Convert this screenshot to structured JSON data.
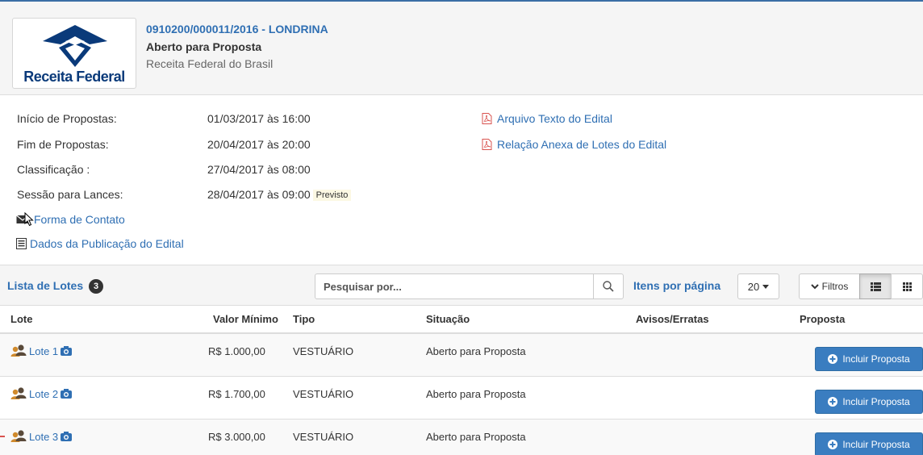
{
  "header": {
    "logo_text": "Receita Federal",
    "process_number": "0910200/000011/2016 - LONDRINA",
    "status": "Aberto para Proposta",
    "organization": "Receita Federal do Brasil"
  },
  "info": {
    "start_label": "Início de Propostas:",
    "start_value": "01/03/2017 às 16:00",
    "end_label": "Fim de Propostas:",
    "end_value": "20/04/2017 às 20:00",
    "class_label": "Classificação :",
    "class_value": "27/04/2017 às 08:00",
    "session_label": "Sessão para Lances:",
    "session_value": "28/04/2017 às 09:00",
    "session_badge": "Previsto"
  },
  "links": {
    "contact": "Forma de Contato",
    "publication": "Dados da Publicação do Edital",
    "edital_text": "Arquivo Texto do Edital",
    "edital_annex": "Relação Anexa de Lotes do Edital"
  },
  "lots_bar": {
    "title": "Lista de Lotes",
    "count": "3",
    "search_placeholder": "Pesquisar por...",
    "per_page_label": "Itens por página",
    "per_page_value": "20",
    "filter_label": "Filtros"
  },
  "table": {
    "columns": {
      "lote": "Lote",
      "valor": "Valor Mínimo",
      "tipo": "Tipo",
      "situacao": "Situação",
      "avisos": "Avisos/Erratas",
      "proposta": "Proposta"
    },
    "rows": [
      {
        "lote": "Lote 1",
        "valor": "R$ 1.000,00",
        "tipo": "VESTUÁRIO",
        "situacao": "Aberto para Proposta",
        "action": "Incluir Proposta"
      },
      {
        "lote": "Lote 2",
        "valor": "R$ 1.700,00",
        "tipo": "VESTUÁRIO",
        "situacao": "Aberto para Proposta",
        "action": "Incluir Proposta"
      },
      {
        "lote": "Lote 3",
        "valor": "R$ 3.000,00",
        "tipo": "VESTUÁRIO",
        "situacao": "Aberto para Proposta",
        "action": "Incluir Proposta"
      }
    ]
  },
  "colors": {
    "link": "#2f6fb3",
    "primary_button": "#3a7dc0",
    "pdf_icon": "#d9534f",
    "header_border": "#3a6ea5"
  }
}
